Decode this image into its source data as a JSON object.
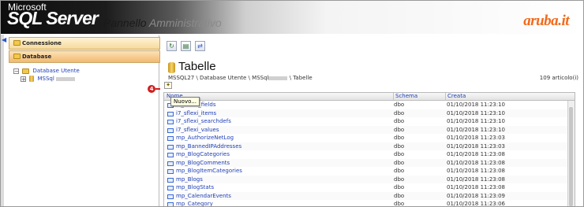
{
  "header": {
    "logo_microsoft": "Microsoft",
    "logo_sqlserver": "SQL Server",
    "title_part1": "Pannello",
    "title_part2": "Amministrativo",
    "brand_name": "aruba",
    "brand_tld": ".it"
  },
  "sidebar": {
    "panels": [
      {
        "label": "Connessione",
        "active": false
      },
      {
        "label": "Database",
        "active": true
      }
    ],
    "tree": {
      "root_label": "Database Utente",
      "child_label": "MSSql"
    }
  },
  "toolbar": {
    "buttons": [
      "refresh-icon",
      "document-icon",
      "sync-icon"
    ]
  },
  "main": {
    "title": "Tabelle",
    "breadcrumb_prefix": "MSSQL27 \\ Database Utente \\ MSSql",
    "breadcrumb_suffix": "\\ Tabelle",
    "count": "109 articolo(i)",
    "annotation_number": "4",
    "new_tooltip": "Nuovo..."
  },
  "grid": {
    "columns": {
      "name": "Nome",
      "schema": "Schema",
      "created": "Creata"
    },
    "rows": [
      {
        "name": "i7_sflexi_fields",
        "schema": "dbo",
        "created": "01/10/2018 11:23:10"
      },
      {
        "name": "i7_sflexi_items",
        "schema": "dbo",
        "created": "01/10/2018 11:23:10"
      },
      {
        "name": "i7_sflexi_searchdefs",
        "schema": "dbo",
        "created": "01/10/2018 11:23:10"
      },
      {
        "name": "i7_sflexi_values",
        "schema": "dbo",
        "created": "01/10/2018 11:23:10"
      },
      {
        "name": "mp_AuthorizeNetLog",
        "schema": "dbo",
        "created": "01/10/2018 11:23:03"
      },
      {
        "name": "mp_BannedIPAddresses",
        "schema": "dbo",
        "created": "01/10/2018 11:23:03"
      },
      {
        "name": "mp_BlogCategories",
        "schema": "dbo",
        "created": "01/10/2018 11:23:08"
      },
      {
        "name": "mp_BlogComments",
        "schema": "dbo",
        "created": "01/10/2018 11:23:08"
      },
      {
        "name": "mp_BlogItemCategories",
        "schema": "dbo",
        "created": "01/10/2018 11:23:08"
      },
      {
        "name": "mp_Blogs",
        "schema": "dbo",
        "created": "01/10/2018 11:23:08"
      },
      {
        "name": "mp_BlogStats",
        "schema": "dbo",
        "created": "01/10/2018 11:23:08"
      },
      {
        "name": "mp_CalendarEvents",
        "schema": "dbo",
        "created": "01/10/2018 11:23:09"
      },
      {
        "name": "mp_Category",
        "schema": "dbo",
        "created": "01/10/2018 11:23:06"
      }
    ]
  },
  "colors": {
    "brand": "#f26a1b",
    "link": "#1f3fb5",
    "annotation": "#d01f1f",
    "panel_active": "#f1b873"
  }
}
